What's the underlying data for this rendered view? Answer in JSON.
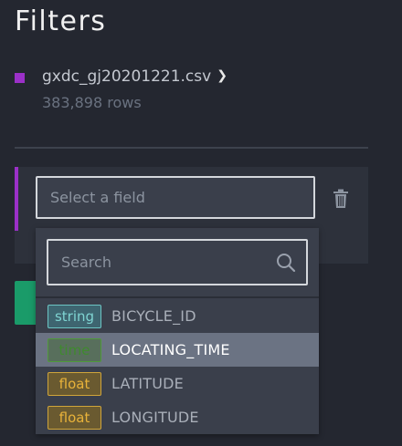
{
  "panel": {
    "title": "Filters"
  },
  "dataset": {
    "name": "gxdc_gj20201221.csv",
    "rows": "383,898 rows",
    "color": "#9b30c8"
  },
  "filter": {
    "field_placeholder": "Select a field"
  },
  "dropdown": {
    "search_placeholder": "Search",
    "fields": [
      {
        "type": "string",
        "name": "BICYCLE_ID",
        "highlighted": false
      },
      {
        "type": "time",
        "name": "LOCATING_TIME",
        "highlighted": true
      },
      {
        "type": "float",
        "name": "LATITUDE",
        "highlighted": false
      },
      {
        "type": "float",
        "name": "LONGITUDE",
        "highlighted": false
      }
    ]
  },
  "icons": {
    "dataset_link": "chevron-right-icon",
    "delete": "trash-icon",
    "search": "search-icon"
  },
  "colors": {
    "accent_purple": "#9b30c8",
    "apply_green": "#1a9b69",
    "type_string": "#7fd4d2",
    "type_time": "#4f9a3a",
    "type_float": "#e8b23a"
  }
}
